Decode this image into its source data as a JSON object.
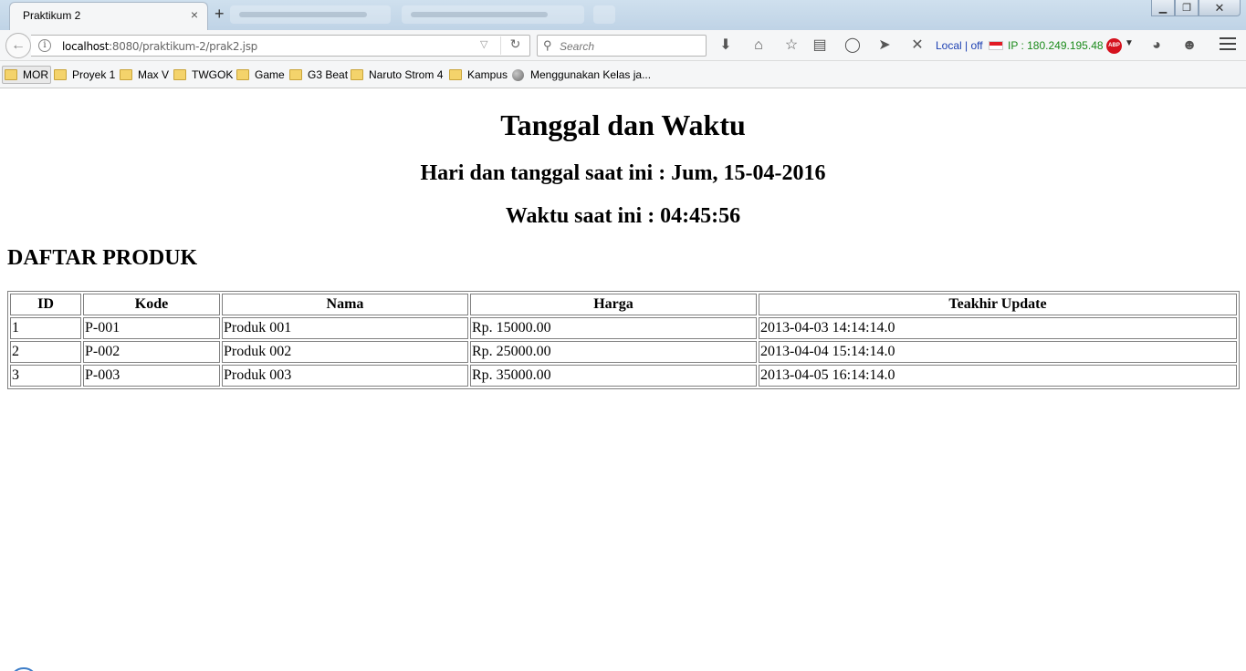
{
  "browser": {
    "tab": {
      "title": "Praktikum 2",
      "close": "×"
    },
    "new_tab": "+",
    "window_controls": {
      "minimize": "▁",
      "restore": "❐",
      "close": "✕"
    },
    "url": {
      "host": "localhost",
      "path": ":8080/praktikum-2/prak2.jsp"
    },
    "search_placeholder": "Search",
    "extensions": {
      "local_status": "Local | off",
      "ip_text": "IP : 180.249.195.48",
      "abp_label": "ABP"
    },
    "icons": [
      "back-arrow-icon",
      "info-icon",
      "dropdown-icon",
      "reload-icon",
      "search-icon",
      "download-icon",
      "home-icon",
      "bookmark-star-icon",
      "reading-list-icon",
      "pocket-icon",
      "send-icon",
      "x-icon",
      "flag-icon",
      "adblock-icon",
      "history-icon",
      "smiley-icon",
      "menu-icon"
    ]
  },
  "bookmarks": [
    {
      "label": "MOR",
      "icon": "folder-icon"
    },
    {
      "label": "Proyek 1",
      "icon": "folder-icon"
    },
    {
      "label": "Max V",
      "icon": "folder-icon"
    },
    {
      "label": "TWGOK",
      "icon": "folder-icon"
    },
    {
      "label": "Game",
      "icon": "folder-icon"
    },
    {
      "label": "G3 Beat",
      "icon": "folder-icon"
    },
    {
      "label": "Naruto Strom 4",
      "icon": "folder-icon"
    },
    {
      "label": "Kampus",
      "icon": "folder-icon"
    },
    {
      "label": "Menggunakan Kelas ja...",
      "icon": "globe-icon"
    }
  ],
  "page": {
    "title": "Tanggal dan Waktu",
    "date_line": "Hari dan tanggal saat ini : Jum, 15-04-2016",
    "time_line": "Waktu saat ini : 04:45:56",
    "section_title": "DAFTAR PRODUK",
    "table": {
      "headers": [
        "ID",
        "Kode",
        "Nama",
        "Harga",
        "Teakhir Update"
      ],
      "rows": [
        [
          "1",
          "P-001",
          "Produk 001",
          "Rp. 15000.00",
          "2013-04-03 14:14:14.0"
        ],
        [
          "2",
          "P-002",
          "Produk 002",
          "Rp. 25000.00",
          "2013-04-04 15:14:14.0"
        ],
        [
          "3",
          "P-003",
          "Produk 003",
          "Rp. 35000.00",
          "2013-04-05 16:14:14.0"
        ]
      ]
    }
  },
  "colors": {
    "local_status": "#1b3fb2",
    "ip_text": "#1a8a1a",
    "abp_badge": "#d5121e"
  }
}
